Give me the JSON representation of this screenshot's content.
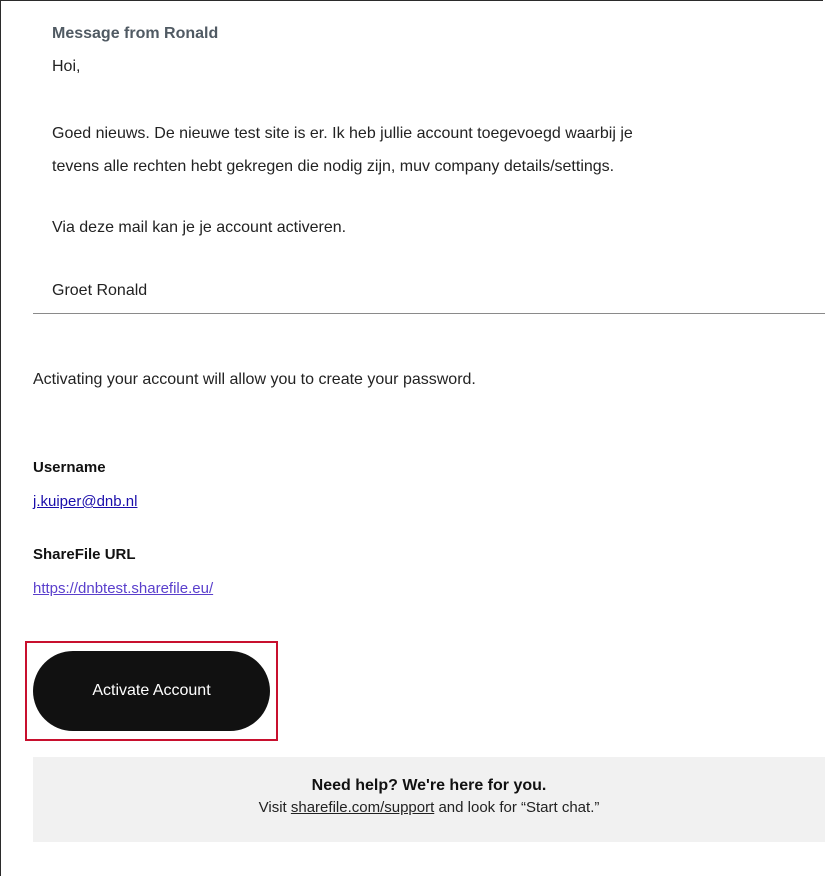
{
  "message": {
    "header": "Message from Ronald",
    "greeting": "Hoi,",
    "paragraph1_line1": "Goed nieuws. De nieuwe test site is er. Ik heb jullie account toegevoegd waarbij je",
    "paragraph1_line2": "tevens alle rechten hebt gekregen die nodig zijn, muv company details/settings.",
    "paragraph2": "Via deze mail kan je je account activeren.",
    "signoff": "Groet Ronald"
  },
  "intro_text": "Activating your account will allow you to create your password.",
  "username": {
    "label": "Username",
    "value": "j.kuiper@dnb.nl"
  },
  "sharefile_url": {
    "label": "ShareFile URL",
    "value": "https://dnbtest.sharefile.eu/"
  },
  "activate_button": {
    "label": "Activate Account"
  },
  "help": {
    "title": "Need help? We're here for you.",
    "text_prefix": "Visit ",
    "link": "sharefile.com/support",
    "text_suffix": " and look for “Start chat.”"
  },
  "colors": {
    "button_bg": "#111111",
    "highlight_border": "#c8102e",
    "help_bg": "#f1f1f1",
    "link_blue": "#1a0dab",
    "link_purple": "#5a3fcc"
  }
}
